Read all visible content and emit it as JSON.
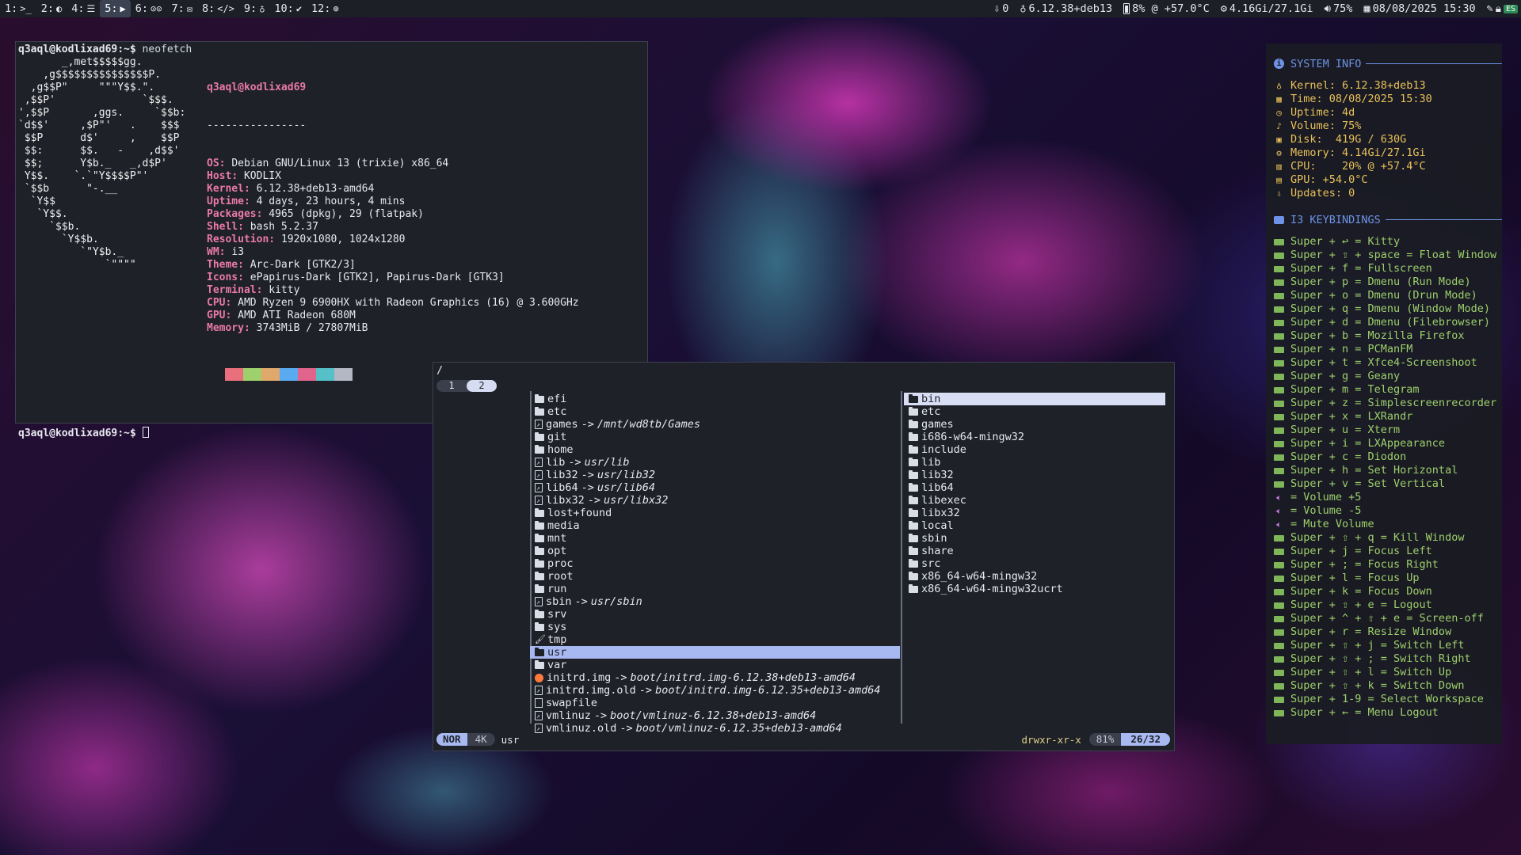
{
  "topbar": {
    "workspaces": [
      {
        "num": "1:",
        "glyph": ">_",
        "active": false
      },
      {
        "num": "2:",
        "glyph": "◐",
        "active": false
      },
      {
        "num": "4:",
        "glyph": "☰",
        "active": false
      },
      {
        "num": "5:",
        "glyph": "▶",
        "active": true
      },
      {
        "num": "6:",
        "glyph": "⊙⊙",
        "active": false
      },
      {
        "num": "7:",
        "glyph": "✉",
        "active": false
      },
      {
        "num": "8:",
        "glyph": "</>",
        "active": false
      },
      {
        "num": "9:",
        "glyph": "♁",
        "active": false
      },
      {
        "num": "10:",
        "glyph": "✔",
        "active": false
      },
      {
        "num": "12:",
        "glyph": "⊕",
        "active": false
      }
    ],
    "updates": "0",
    "kernel": "6.12.38+deb13",
    "cpu": "8% @ +57.0°C",
    "memory": "4.16Gi/27.1Gi",
    "volume": "75%",
    "datetime": "08/08/2025 15:30",
    "lang": "ES"
  },
  "terminal": {
    "prompt": "q3aql@kodlixad69:~$",
    "command": "neofetch",
    "ascii": [
      "       _,met$$$$$gg.",
      "    ,g$$$$$$$$$$$$$$$P.",
      "  ,g$$P\"     \"\"\"Y$$.\".",
      " ,$$P'              `$$$.",
      "',$$P       ,ggs.     `$$b:",
      "`d$$'     ,$P\"'   .    $$$",
      " $$P      d$'     ,    $$P",
      " $$:      $$.   -    ,d$$'",
      " $$;      Y$b._   _,d$P'",
      " Y$$.    `.`\"Y$$$$P\"'",
      " `$$b      \"-.__",
      "  `Y$$",
      "   `Y$$.",
      "     `$$b.",
      "       `Y$$b.",
      "          `\"Y$b._",
      "              `\"\"\"\""
    ],
    "title": "q3aql@kodlixad69",
    "separator": "----------------",
    "info": [
      {
        "k": "OS",
        "v": "Debian GNU/Linux 13 (trixie) x86_64"
      },
      {
        "k": "Host",
        "v": "KODLIX"
      },
      {
        "k": "Kernel",
        "v": "6.12.38+deb13-amd64"
      },
      {
        "k": "Uptime",
        "v": "4 days, 23 hours, 4 mins"
      },
      {
        "k": "Packages",
        "v": "4965 (dpkg), 29 (flatpak)"
      },
      {
        "k": "Shell",
        "v": "bash 5.2.37"
      },
      {
        "k": "Resolution",
        "v": "1920x1080, 1024x1280"
      },
      {
        "k": "WM",
        "v": "i3"
      },
      {
        "k": "Theme",
        "v": "Arc-Dark [GTK2/3]"
      },
      {
        "k": "Icons",
        "v": "ePapirus-Dark [GTK2], Papirus-Dark [GTK3]"
      },
      {
        "k": "Terminal",
        "v": "kitty"
      },
      {
        "k": "CPU",
        "v": "AMD Ryzen 9 6900HX with Radeon Graphics (16) @ 3.600GHz"
      },
      {
        "k": "GPU",
        "v": "AMD ATI Radeon 680M"
      },
      {
        "k": "Memory",
        "v": "3743MiB / 27807MiB"
      }
    ],
    "swatches": [
      "#1e2128",
      "#ea6f7d",
      "#9ed06c",
      "#e0a86a",
      "#5aaaf0",
      "#e0648c",
      "#56c0c8",
      "#b4b8c4"
    ]
  },
  "ranger": {
    "path": "/",
    "tabs": [
      "1",
      "2"
    ],
    "active_tab": 1,
    "middle": [
      {
        "name": "efi",
        "type": "folder"
      },
      {
        "name": "etc",
        "type": "folder"
      },
      {
        "name": "games",
        "type": "link",
        "target": "/mnt/wd8tb/Games"
      },
      {
        "name": "git",
        "type": "folder"
      },
      {
        "name": "home",
        "type": "folder"
      },
      {
        "name": "lib",
        "type": "link",
        "target": "usr/lib"
      },
      {
        "name": "lib32",
        "type": "link",
        "target": "usr/lib32"
      },
      {
        "name": "lib64",
        "type": "link",
        "target": "usr/lib64"
      },
      {
        "name": "libx32",
        "type": "link",
        "target": "usr/libx32"
      },
      {
        "name": "lost+found",
        "type": "folder"
      },
      {
        "name": "media",
        "type": "folder"
      },
      {
        "name": "mnt",
        "type": "folder"
      },
      {
        "name": "opt",
        "type": "folder"
      },
      {
        "name": "proc",
        "type": "folder"
      },
      {
        "name": "root",
        "type": "folder"
      },
      {
        "name": "run",
        "type": "folder"
      },
      {
        "name": "sbin",
        "type": "link",
        "target": "usr/sbin"
      },
      {
        "name": "srv",
        "type": "folder"
      },
      {
        "name": "sys",
        "type": "folder"
      },
      {
        "name": "tmp",
        "type": "brush"
      },
      {
        "name": "usr",
        "type": "folder",
        "selected": true
      },
      {
        "name": "var",
        "type": "folder"
      },
      {
        "name": "initrd.img",
        "type": "img",
        "target": "boot/initrd.img-6.12.38+deb13-amd64"
      },
      {
        "name": "initrd.img.old",
        "type": "link",
        "target": "boot/initrd.img-6.12.35+deb13-amd64"
      },
      {
        "name": "swapfile",
        "type": "file"
      },
      {
        "name": "vmlinuz",
        "type": "link",
        "target": "boot/vmlinuz-6.12.38+deb13-amd64"
      },
      {
        "name": "vmlinuz.old",
        "type": "link",
        "target": "boot/vmlinuz-6.12.35+deb13-amd64"
      }
    ],
    "right": [
      {
        "name": "bin",
        "selected": true
      },
      {
        "name": "etc"
      },
      {
        "name": "games"
      },
      {
        "name": "i686-w64-mingw32"
      },
      {
        "name": "include"
      },
      {
        "name": "lib"
      },
      {
        "name": "lib32"
      },
      {
        "name": "lib64"
      },
      {
        "name": "libexec"
      },
      {
        "name": "libx32"
      },
      {
        "name": "local"
      },
      {
        "name": "sbin"
      },
      {
        "name": "share"
      },
      {
        "name": "src"
      },
      {
        "name": "x86_64-w64-mingw32"
      },
      {
        "name": "x86_64-w64-mingw32ucrt"
      }
    ],
    "status": {
      "mode": "NOR",
      "size": "4K",
      "current": "usr",
      "perms": "drwxr-xr-x",
      "percent": "81%",
      "position": "26/32"
    }
  },
  "conky": {
    "system_title": "SYSTEM INFO",
    "system": [
      {
        "icon": "♁",
        "text": "Kernel: 6.12.38+deb13"
      },
      {
        "icon": "▦",
        "text": "Time: 08/08/2025 15:30"
      },
      {
        "icon": "◷",
        "text": "Uptime: 4d"
      },
      {
        "icon": "♪",
        "text": "Volume: 75%"
      },
      {
        "icon": "▣",
        "text": "Disk:  419G / 630G"
      },
      {
        "icon": "⚙",
        "text": "Memory: 4.14Gi/27.1Gi"
      },
      {
        "icon": "▥",
        "text": "CPU:    20% @ +57.4°C"
      },
      {
        "icon": "▤",
        "text": "GPU: +54.0°C"
      },
      {
        "icon": "⇩",
        "text": "Updates: 0"
      }
    ],
    "keys_title": "I3 KEYBINDINGS",
    "keys": [
      {
        "icon": "kb",
        "text": "Super + ↩ = Kitty"
      },
      {
        "icon": "kb",
        "text": "Super + ⇧ + space = Float Window"
      },
      {
        "icon": "kb",
        "text": "Super + f = Fullscreen"
      },
      {
        "icon": "kb",
        "text": "Super + p = Dmenu (Run Mode)"
      },
      {
        "icon": "kb",
        "text": "Super + o = Dmenu (Drun Mode)"
      },
      {
        "icon": "kb",
        "text": "Super + q = Dmenu (Window Mode)"
      },
      {
        "icon": "kb",
        "text": "Super + d = Dmenu (Filebrowser)"
      },
      {
        "icon": "kb",
        "text": "Super + b = Mozilla Firefox"
      },
      {
        "icon": "kb",
        "text": "Super + n = PCManFM"
      },
      {
        "icon": "kb",
        "text": "Super + t = Xfce4-Screenshoot"
      },
      {
        "icon": "kb",
        "text": "Super + g = Geany"
      },
      {
        "icon": "kb",
        "text": "Super + m = Telegram"
      },
      {
        "icon": "kb",
        "text": "Super + z = Simplescreenrecorder"
      },
      {
        "icon": "kb",
        "text": "Super + x = LXRandr"
      },
      {
        "icon": "kb",
        "text": "Super + u = Xterm"
      },
      {
        "icon": "kb",
        "text": "Super + i = LXAppearance"
      },
      {
        "icon": "kb",
        "text": "Super + c = Diodon"
      },
      {
        "icon": "kb",
        "text": "Super + h = Set Horizontal"
      },
      {
        "icon": "kb",
        "text": "Super + v = Set Vertical"
      },
      {
        "icon": "vol",
        "text": "= Volume +5"
      },
      {
        "icon": "vol",
        "text": "= Volume -5"
      },
      {
        "icon": "vol",
        "text": "= Mute Volume"
      },
      {
        "icon": "kb",
        "text": "Super + ⇧ + q = Kill Window"
      },
      {
        "icon": "kb",
        "text": "Super + j = Focus Left"
      },
      {
        "icon": "kb",
        "text": "Super + ; = Focus Right"
      },
      {
        "icon": "kb",
        "text": "Super + l = Focus Up"
      },
      {
        "icon": "kb",
        "text": "Super + k = Focus Down"
      },
      {
        "icon": "kb",
        "text": "Super + ⇧ + e = Logout"
      },
      {
        "icon": "kb",
        "text": "Super + ^ + ⇧ + e = Screen-off"
      },
      {
        "icon": "kb",
        "text": "Super + r = Resize Window"
      },
      {
        "icon": "kb",
        "text": "Super + ⇧ + j = Switch Left"
      },
      {
        "icon": "kb",
        "text": "Super + ⇧ + ; = Switch Right"
      },
      {
        "icon": "kb",
        "text": "Super + ⇧ + l = Switch Up"
      },
      {
        "icon": "kb",
        "text": "Super + ⇧ + k = Switch Down"
      },
      {
        "icon": "kb",
        "text": "Super + 1-9 = Select Workspace"
      },
      {
        "icon": "kb",
        "text": "Super + ← = Menu Logout"
      }
    ]
  }
}
